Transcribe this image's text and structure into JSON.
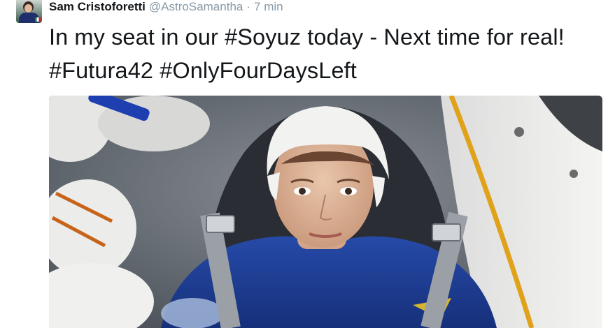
{
  "tweet": {
    "author": {
      "display_name": "Sam Cristoforetti",
      "handle": "@AstroSamantha"
    },
    "separator": "·",
    "timestamp": "7 min",
    "text_parts": [
      {
        "text": "In my seat in our ",
        "type": "text"
      },
      {
        "text": "#Soyuz",
        "type": "hashtag"
      },
      {
        "text": " today - Next time for real! ",
        "type": "text"
      },
      {
        "text": "#Futura42",
        "type": "hashtag"
      },
      {
        "text": " ",
        "type": "text"
      },
      {
        "text": "#OnlyFourDaysLeft",
        "type": "hashtag"
      }
    ],
    "media": {
      "type": "photo"
    }
  },
  "colors": {
    "text": "#14171a",
    "secondary": "#8899a6",
    "uniform": "#1c3c8c",
    "cap": "#f2f2f0",
    "accent_stripe": "#e0a21a"
  }
}
